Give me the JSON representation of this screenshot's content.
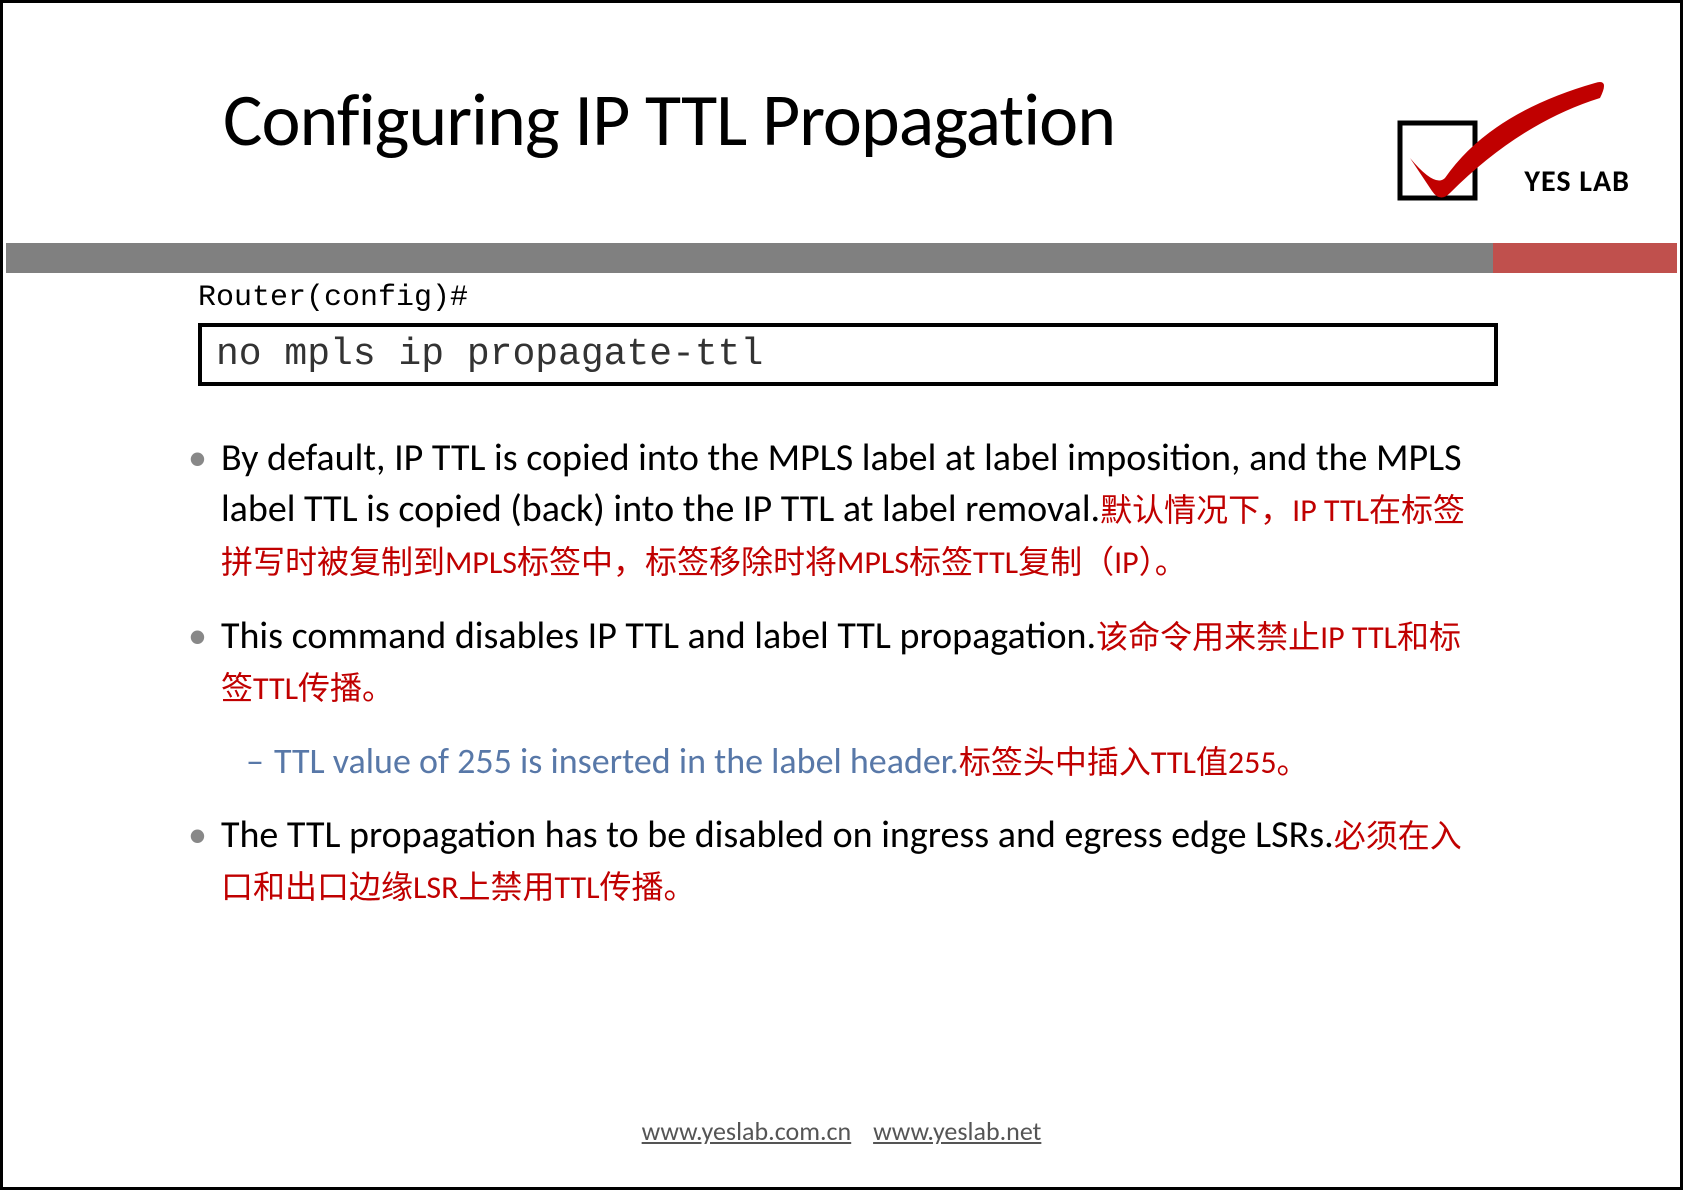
{
  "title": "Configuring IP TTL Propagation",
  "logo": {
    "text": "YES LAB"
  },
  "prompt": "Router(config)#",
  "command": "no mpls ip propagate-ttl",
  "bullets": [
    {
      "en": "By default, IP TTL is copied into the MPLS label at label imposition, and the MPLS label TTL is copied (back) into the IP TTL at label removal.",
      "zh": "默认情况下，IP TTL在标签拼写时被复制到MPLS标签中，标签移除时将MPLS标签TTL复制（IP）。"
    },
    {
      "en": "This command disables IP TTL and label TTL propagation.",
      "zh": "该命令用来禁止IP TTL和标签TTL传播。",
      "sub": {
        "en": "TTL value of 255 is inserted in the label header.",
        "zh": "标签头中插入TTL值255。"
      }
    },
    {
      "en": "The TTL propagation has to be disabled on ingress and egress edge LSRs.",
      "zh": "必须在入口和出口边缘LSR上禁用TTL传播。"
    }
  ],
  "footer": {
    "link1": "www.yeslab.com.cn",
    "link2": "www.yeslab.net"
  }
}
